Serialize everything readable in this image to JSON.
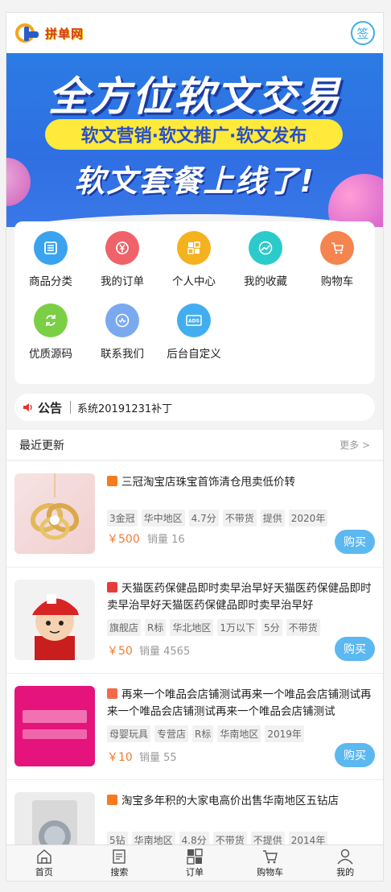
{
  "header": {
    "logo_text": "拼单网",
    "sign_label": "签"
  },
  "banner": {
    "headline": "全方位软文交易",
    "pill": "软文营销·软文推广·软文发布",
    "subline": "软文套餐上线了!"
  },
  "menu": [
    {
      "label": "商品分类",
      "icon": "list-icon",
      "color": "#3aa3f0"
    },
    {
      "label": "我的订单",
      "icon": "yen-icon",
      "color": "#f0626a"
    },
    {
      "label": "个人中心",
      "icon": "grid-icon",
      "color": "#f5b21f"
    },
    {
      "label": "我的收藏",
      "icon": "trend-icon",
      "color": "#2ccbcb"
    },
    {
      "label": "购物车",
      "icon": "cart-icon",
      "color": "#f5844e"
    },
    {
      "label": "优质源码",
      "icon": "refresh-icon",
      "color": "#7bcf45"
    },
    {
      "label": "联系我们",
      "icon": "chat-icon",
      "color": "#7aa9f0"
    },
    {
      "label": "后台自定义",
      "icon": "ad-icon",
      "color": "#42aef0"
    }
  ],
  "notice": {
    "title": "公告",
    "text": "系统20191231补丁"
  },
  "recent": {
    "title": "最近更新",
    "more": "更多 >"
  },
  "items": [
    {
      "title": "三冠淘宝店珠宝首饰清仓甩卖低价转",
      "badge_color": "#f47c1f",
      "tags": [
        "3金冠",
        "华中地区",
        "4.7分",
        "不带货",
        "提供",
        "2020年"
      ],
      "price": "￥500",
      "sales": "销量 16",
      "buy": "购买"
    },
    {
      "title": "天猫医药保健品即时卖早治早好天猫医药保健品即时卖早治早好天猫医药保健品即时卖早治早好",
      "badge_color": "#e83b3b",
      "tags": [
        "旗舰店",
        "R标",
        "华北地区",
        "1万以下",
        "5分",
        "不带货"
      ],
      "price": "￥50",
      "sales": "销量 4565",
      "buy": "购买"
    },
    {
      "title": "再来一个唯品会店铺测试再来一个唯品会店铺测试再来一个唯品会店铺测试再来一个唯品会店铺测试",
      "badge_color": "#f26a4a",
      "tags": [
        "母婴玩具",
        "专营店",
        "R标",
        "华南地区",
        "2019年"
      ],
      "price": "￥10",
      "sales": "销量 55",
      "buy": "购买"
    },
    {
      "title": "淘宝多年积的大家电高价出售华南地区五钻店",
      "badge_color": "#f47c1f",
      "tags": [
        "5钻",
        "华南地区",
        "4.8分",
        "不带货",
        "不提供",
        "2014年"
      ],
      "price": "",
      "sales": "",
      "buy": ""
    }
  ],
  "tabbar": [
    {
      "label": "首页",
      "icon": "home-icon"
    },
    {
      "label": "搜索",
      "icon": "doc-icon"
    },
    {
      "label": "订单",
      "icon": "grid-icon"
    },
    {
      "label": "购物车",
      "icon": "cart-icon"
    },
    {
      "label": "我的",
      "icon": "user-icon"
    }
  ]
}
